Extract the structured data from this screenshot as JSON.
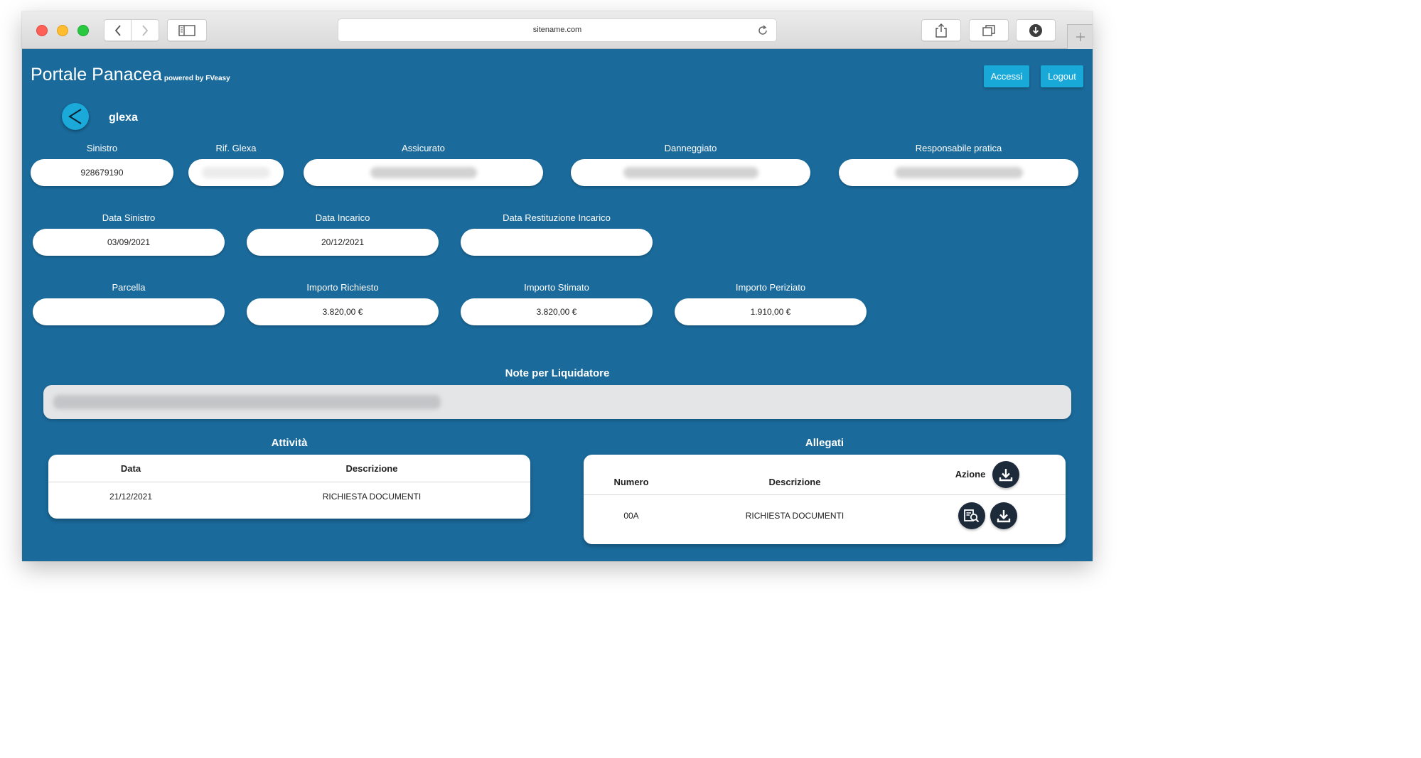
{
  "browser": {
    "url": "sitename.com",
    "icons": {
      "back": "chevron-left-icon",
      "forward": "chevron-right-icon",
      "sidebar": "sidebar-icon",
      "reload": "reload-icon",
      "share": "share-icon",
      "tabs": "tabs-icon",
      "downloads": "download-circle-icon",
      "new_tab": "plus-icon"
    }
  },
  "header": {
    "title": "Portale Panacea",
    "subtitle": "powered by FVeasy",
    "buttons": {
      "accessi": "Accessi",
      "logout": "Logout"
    }
  },
  "client": {
    "name": "glexa"
  },
  "fields": {
    "sinistro": {
      "label": "Sinistro",
      "value": "928679190"
    },
    "rif_glexa": {
      "label": "Rif. Glexa",
      "value": ""
    },
    "assicurato": {
      "label": "Assicurato",
      "value": ""
    },
    "danneggiato": {
      "label": "Danneggiato",
      "value": ""
    },
    "responsabile": {
      "label": "Responsabile pratica",
      "value": ""
    },
    "data_sinistro": {
      "label": "Data Sinistro",
      "value": "03/09/2021"
    },
    "data_incarico": {
      "label": "Data Incarico",
      "value": "20/12/2021"
    },
    "data_restituzione": {
      "label": "Data Restituzione Incarico",
      "value": ""
    },
    "parcella": {
      "label": "Parcella",
      "value": ""
    },
    "importo_richiesto": {
      "label": "Importo Richiesto",
      "value": "3.820,00 €"
    },
    "importo_stimato": {
      "label": "Importo Stimato",
      "value": "3.820,00 €"
    },
    "importo_periziato": {
      "label": "Importo Periziato",
      "value": "1.910,00 €"
    }
  },
  "notes": {
    "title": "Note per Liquidatore",
    "value": ""
  },
  "attivita": {
    "title": "Attività",
    "columns": [
      "Data",
      "Descrizione"
    ],
    "rows": [
      {
        "data": "21/12/2021",
        "descrizione": "RICHIESTA DOCUMENTI"
      }
    ]
  },
  "allegati": {
    "title": "Allegati",
    "columns": [
      "Numero",
      "Descrizione",
      "Azione"
    ],
    "rows": [
      {
        "numero": "00A",
        "descrizione": "RICHIESTA DOCUMENTI"
      }
    ]
  },
  "colors": {
    "page_bg": "#1a6a9b",
    "accent_button": "#19a9d8",
    "action_button": "#1c2a3a"
  }
}
